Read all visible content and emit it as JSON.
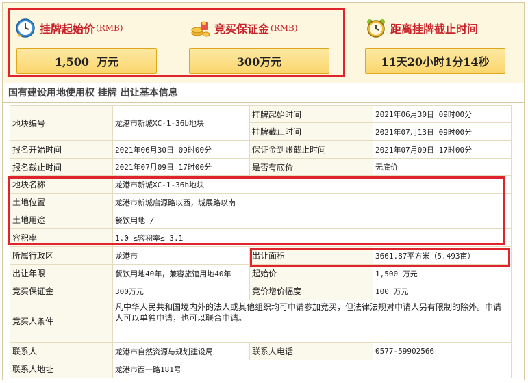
{
  "summary": {
    "starting_price": {
      "title": "挂牌起始价",
      "unit": "(RMB)",
      "value": "1,500  万元"
    },
    "deposit": {
      "title": "竞买保证金",
      "unit": "(RMB)",
      "value": "300万元"
    },
    "countdown": {
      "title": "距离挂牌截止时间",
      "value": "11天20小时1分14秒"
    }
  },
  "section_title": "国有建设用地使用权 挂牌 出让基本信息",
  "table": {
    "parcel_no_label": "地块编号",
    "parcel_no": "龙港市新城XC-1-36b地块",
    "list_start_label": "挂牌起始时间",
    "list_start": "2021年06月30日 09时00分",
    "list_end_label": "挂牌截止时间",
    "list_end": "2021年07月13日 09时00分",
    "reg_start_label": "报名开始时间",
    "reg_start": "2021年06月30日 09时00分",
    "deposit_deadline_label": "保证金到账截止时间",
    "deposit_deadline": "2021年07月09日 17时00分",
    "reg_end_label": "报名截止时间",
    "reg_end": "2021年07月09日 17时00分",
    "reserve_label": "是否有底价",
    "reserve": "无底价",
    "parcel_name_label": "地块名称",
    "parcel_name": "龙港市新城XC-1-36b地块",
    "location_label": "土地位置",
    "location": "龙港市新城启源路以西，城展路以南",
    "usage_label": "土地用途",
    "usage": "餐饮用地 /",
    "far_label": "容积率",
    "far": "1.0 ≤容积率≤ 3.1",
    "district_label": "所属行政区",
    "district": "龙港市",
    "area_label": "出让面积",
    "area": "3661.87平方米（5.493亩）",
    "term_label": "出让年限",
    "term": "餐饮用地40年，兼容旅馆用地40年",
    "start_price_label": "起始价",
    "start_price": "1,500 万元",
    "bid_deposit_label": "竞买保证金",
    "bid_deposit": "300万元",
    "increment_label": "竞价增价幅度",
    "increment": "100 万元",
    "conditions_label": "竞买人条件",
    "conditions": "凡中华人民共和国境内外的法人或其他组织均可申请参加竞买，但法律法规对申请人另有限制的除外。申请人可以单独申请，也可以联合申请。",
    "contact_label": "联系人",
    "contact": "龙港市自然资源与规划建设局",
    "phone_label": "联系人电话",
    "phone": "0577-59902566",
    "address_label": "联系人地址",
    "address": "龙港市西一路181号"
  },
  "colors": {
    "title_red": "#c8222a",
    "highlight_red": "#e0242b",
    "panel_bg": "#fdf7df",
    "value_box": "#fbd66e"
  },
  "icons": [
    "clock-icon",
    "coins-icon",
    "alarm-clock-icon"
  ]
}
